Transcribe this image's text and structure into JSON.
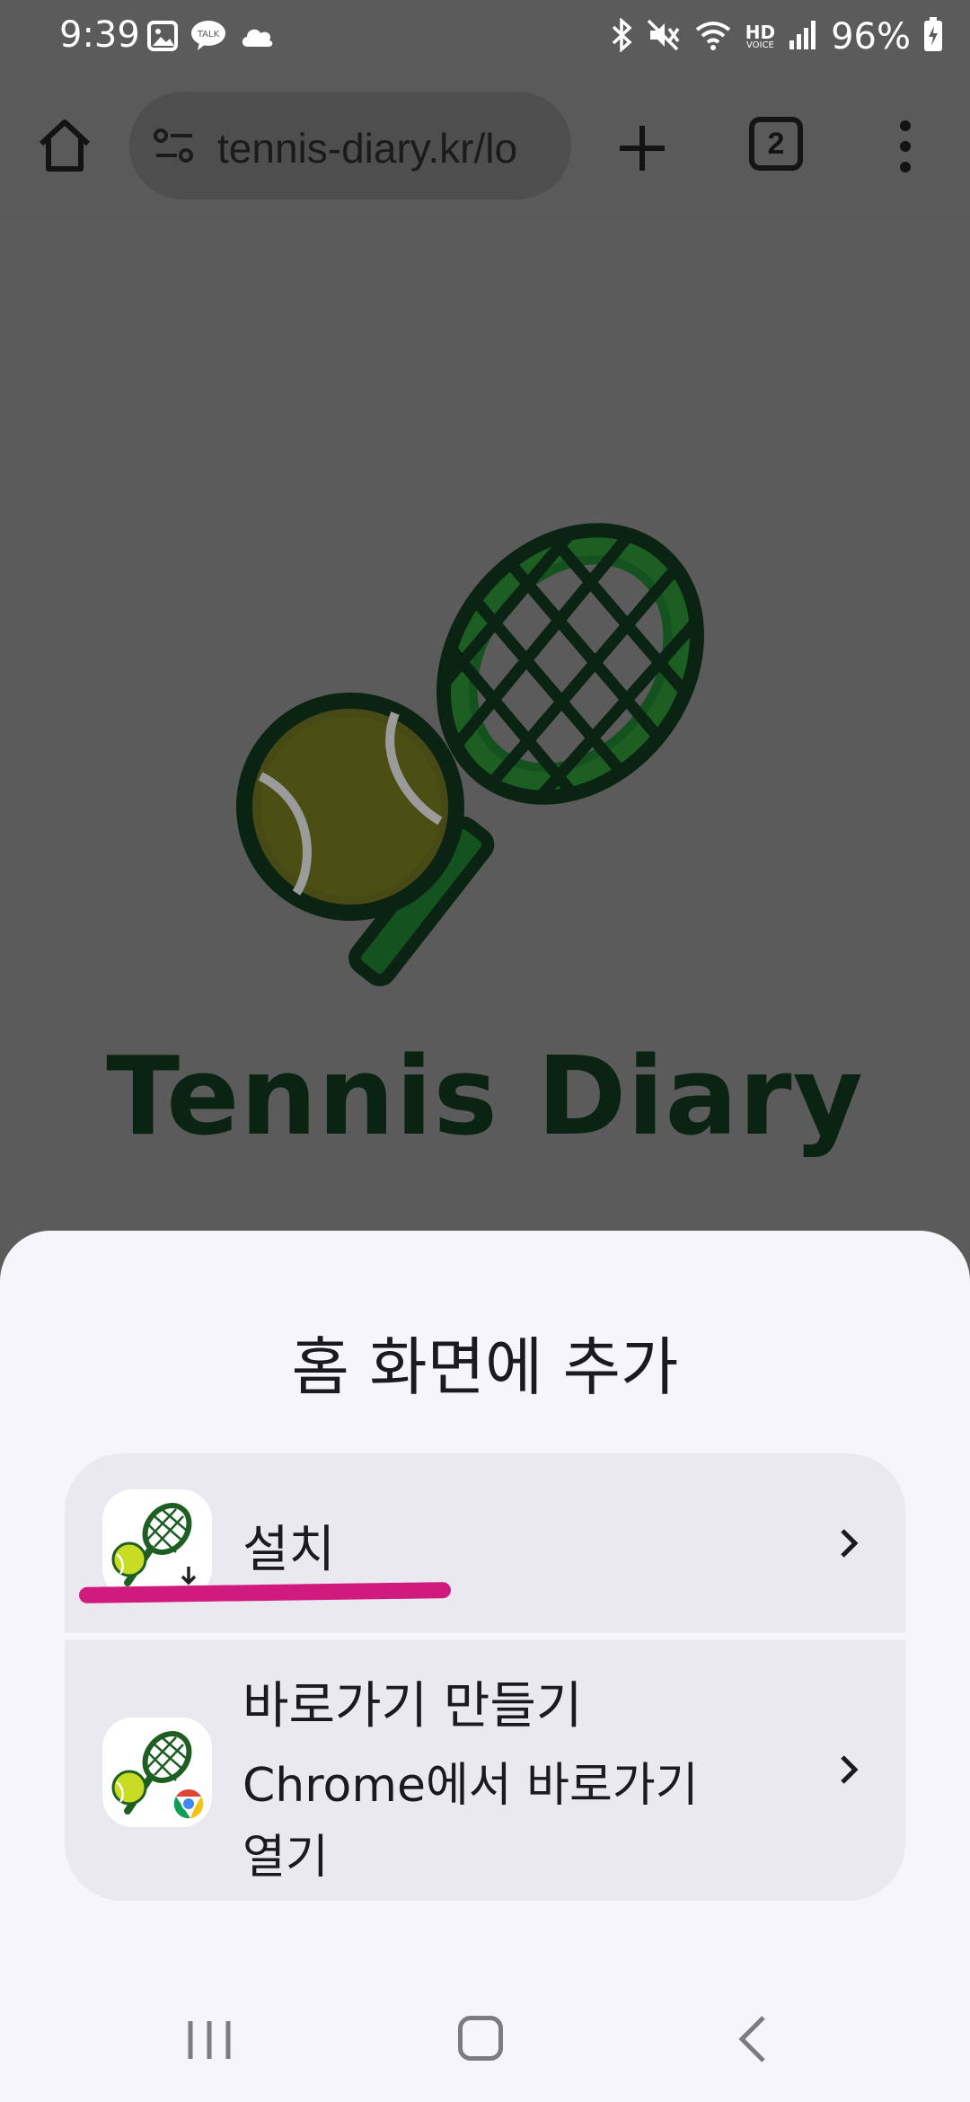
{
  "status_bar": {
    "time": "9:39",
    "notification_icons": [
      "gallery-icon",
      "kakaotalk-icon",
      "cloud-icon"
    ],
    "kakao_badge": "TALK",
    "system_icons": [
      "bluetooth-icon",
      "mute-icon",
      "wifi-icon",
      "hd-voice-icon",
      "signal-icon"
    ],
    "hd_voice_top": "HD",
    "hd_voice_bottom": "VOICE",
    "battery": "96%"
  },
  "browser": {
    "url": "tennis-diary.kr/lo",
    "tab_count": "2"
  },
  "page": {
    "logo_text": "Tennis Diary"
  },
  "sheet": {
    "title": "홈 화면에 추가",
    "install_label": "설치",
    "shortcut_label": "바로가기 만들기",
    "shortcut_sub": "Chrome에서 바로가기 열기"
  },
  "colors": {
    "highlight": "#d11a7d",
    "logo_dark_green": "#0a2313",
    "ball_yellow": "#c8dc24"
  }
}
